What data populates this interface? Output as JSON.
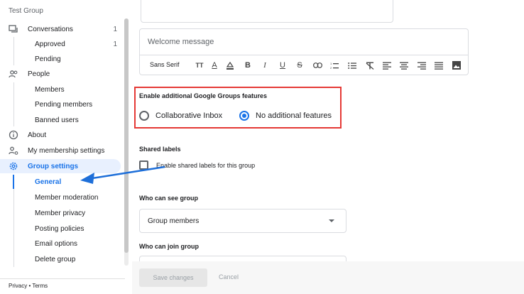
{
  "sidebar": {
    "group_name": "Test Group",
    "items": [
      {
        "label": "Conversations",
        "count": "1",
        "icon": "chat-bubbles-icon"
      },
      {
        "label": "Approved",
        "count": "1"
      },
      {
        "label": "Pending"
      },
      {
        "label": "People",
        "icon": "people-icon"
      },
      {
        "label": "Members"
      },
      {
        "label": "Pending members"
      },
      {
        "label": "Banned users"
      },
      {
        "label": "About",
        "icon": "info-icon"
      },
      {
        "label": "My membership settings",
        "icon": "person-settings-icon"
      },
      {
        "label": "Group settings",
        "icon": "gear-icon"
      },
      {
        "label": "General"
      },
      {
        "label": "Member moderation"
      },
      {
        "label": "Member privacy"
      },
      {
        "label": "Posting policies"
      },
      {
        "label": "Email options"
      },
      {
        "label": "Delete group"
      }
    ],
    "footer": "Privacy • Terms"
  },
  "main": {
    "welcome_placeholder": "Welcome message",
    "toolbar": {
      "font": "Sans Serif",
      "buttons": [
        "font-size-icon",
        "text-color-icon",
        "highlight-icon",
        "bold-icon",
        "italic-icon",
        "underline-icon",
        "strikethrough-icon",
        "link-icon",
        "numbered-list-icon",
        "bulleted-list-icon",
        "clear-format-icon",
        "align-left-icon",
        "align-center-icon",
        "align-right-icon",
        "justify-icon",
        "image-icon"
      ]
    },
    "features": {
      "heading": "Enable additional Google Groups features",
      "option_inbox": "Collaborative Inbox",
      "option_none": "No additional features",
      "selected": "No additional features"
    },
    "shared_labels": {
      "heading": "Shared labels",
      "checkbox_label": "Enable shared labels for this group"
    },
    "who_can_see": {
      "heading": "Who can see group",
      "value": "Group members"
    },
    "who_can_join": {
      "heading": "Who can join group"
    },
    "actions": {
      "save": "Save changes",
      "cancel": "Cancel"
    }
  },
  "colors": {
    "accent": "#1a73e8",
    "annotation": "#e53935",
    "arrow": "#1e6fd9"
  }
}
